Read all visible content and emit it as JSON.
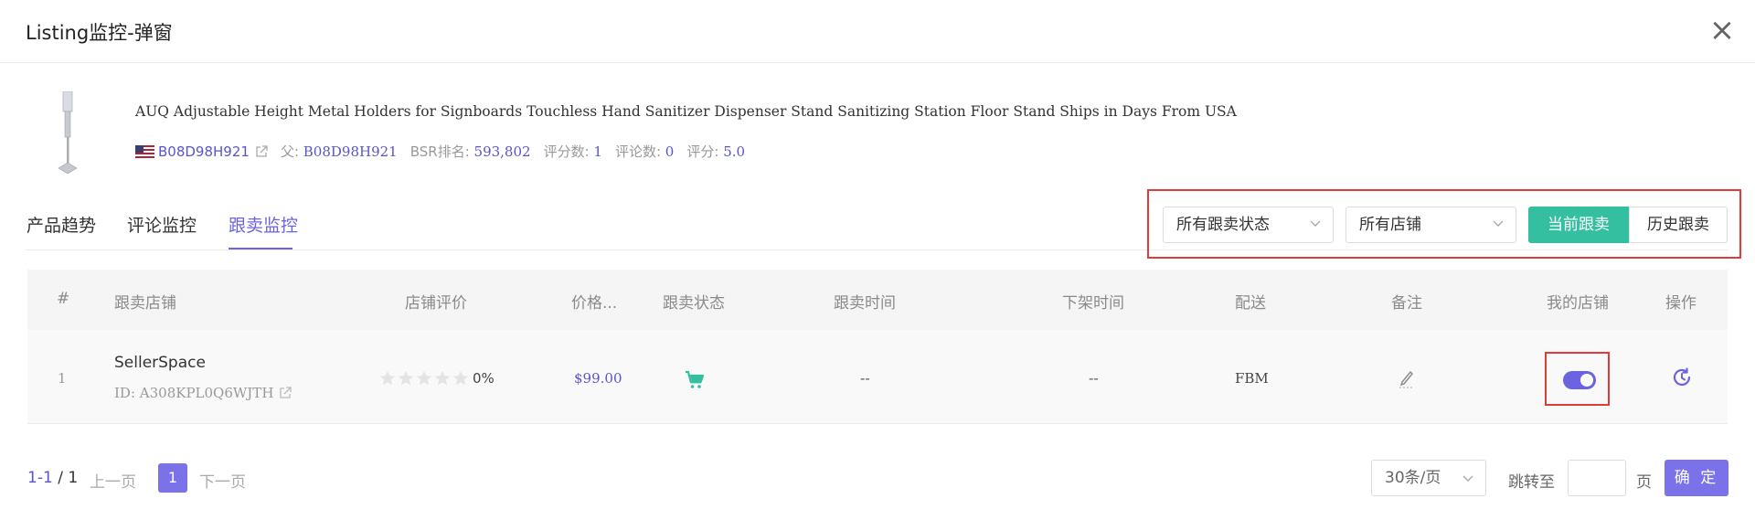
{
  "header": {
    "title": "Listing监控-弹窗",
    "close_icon": "close-icon"
  },
  "product": {
    "title": "AUQ Adjustable Height Metal Holders for Signboards Touchless Hand Sanitizer Dispenser Stand Sanitizing Station Floor Stand Ships in Days From USA",
    "asin": "B08D98H921",
    "parent_label": "父:",
    "parent_asin": "B08D98H921",
    "bsr_label": "BSR排名:",
    "bsr_value": "593,802",
    "rating_count_label": "评分数:",
    "rating_count": "1",
    "review_count_label": "评论数:",
    "review_count": "0",
    "score_label": "评分:",
    "score": "5.0",
    "marketplace_flag": "us-flag-icon"
  },
  "tabs": [
    {
      "label": "产品趋势"
    },
    {
      "label": "评论监控"
    },
    {
      "label": "跟卖监控",
      "active": true
    }
  ],
  "filters": {
    "status_select": "所有跟卖状态",
    "store_select": "所有店铺",
    "current_button": "当前跟卖",
    "history_button": "历史跟卖"
  },
  "table": {
    "headers": [
      "#",
      "跟卖店铺",
      "店铺评价",
      "价格...",
      "跟卖状态",
      "跟卖时间",
      "下架时间",
      "配送",
      "备注",
      "我的店铺",
      "操作"
    ],
    "rows": [
      {
        "index": "1",
        "store_name": "SellerSpace",
        "store_id": "ID: A308KPL0Q6WJTH",
        "rating_stars": 0,
        "rating_percent": "0%",
        "price": "$99.00",
        "status_icon": "cart-icon",
        "start_time": "--",
        "end_time": "--",
        "delivery": "FBM",
        "note_icon": "edit-icon",
        "my_store": true,
        "action_icon": "history-icon"
      }
    ]
  },
  "pagination": {
    "range": "1-1",
    "total": "/ 1",
    "prev": "上一页",
    "current_page": "1",
    "next": "下一页",
    "per_page": "30条/页",
    "jump_label": "跳转至",
    "page_unit": "页",
    "confirm": "确 定"
  },
  "colors": {
    "accent": "#6c63e0",
    "green": "#33bfa0",
    "highlight": "#e03b3b",
    "link": "#5a55c9"
  }
}
